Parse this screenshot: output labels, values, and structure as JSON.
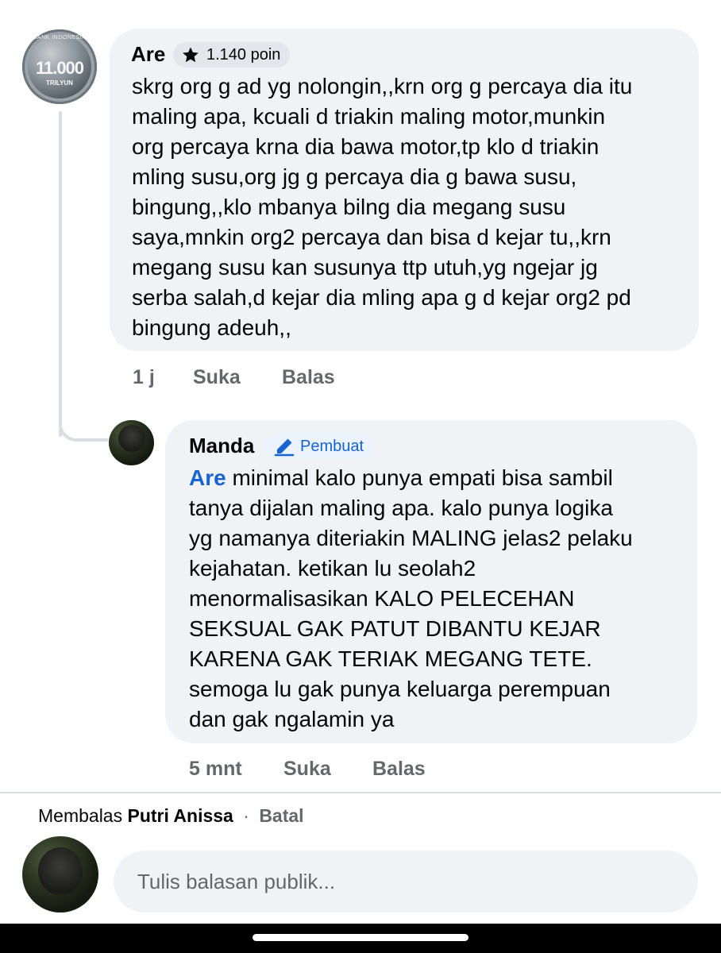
{
  "comment": {
    "author": "Are",
    "badge_points": "1.140 poin",
    "avatar_coin": {
      "top": "BANK INDONESIA",
      "value": "11.000",
      "sub": "TRILYUN"
    },
    "text": "skrg org g ad yg nolongin,,krn org g percaya dia itu\nmaling apa, kcuali d triakin maling motor,munkin\norg percaya krna dia bawa motor,tp klo d triakin\nmling susu,org jg g percaya dia g bawa susu,\nbingung,,klo mbanya bilng dia megang susu\nsaya,mnkin org2 percaya dan bisa d kejar tu,,krn\nmegang susu kan susunya ttp utuh,yg ngejar jg\nserba salah,d kejar dia mling apa g d kejar org2 pd\nbingung adeuh,,",
    "time": "1 j",
    "like_label": "Suka",
    "reply_label": "Balas"
  },
  "reply": {
    "author": "Manda",
    "badge_label": "Pembuat",
    "mention": "Are",
    "text_first": " minimal kalo punya empati bisa sambil",
    "text_rest": "tanya dijalan maling apa. kalo punya logika\nyg namanya diteriakin MALING jelas2 pelaku\nkejahatan. ketikan lu seolah2\nmenormalisasikan KALO PELECEHAN\nSEKSUAL GAK PATUT DIBANTU KEJAR\nKARENA GAK TERIAK MEGANG TETE.\nsemoga lu gak punya keluarga perempuan\ndan gak ngalamin ya",
    "time": "5 mnt",
    "like_label": "Suka",
    "reply_label": "Balas"
  },
  "composer": {
    "replying_prefix": "Membalas",
    "replying_to": "Putri Anissa",
    "separator": "·",
    "cancel_label": "Batal",
    "placeholder": "Tulis balasan publik..."
  },
  "colors": {
    "bubble": "#f0f2f5",
    "mention": "#1763cf",
    "meta": "#65676b",
    "creator_badge_bg": "#ebf3ff"
  }
}
